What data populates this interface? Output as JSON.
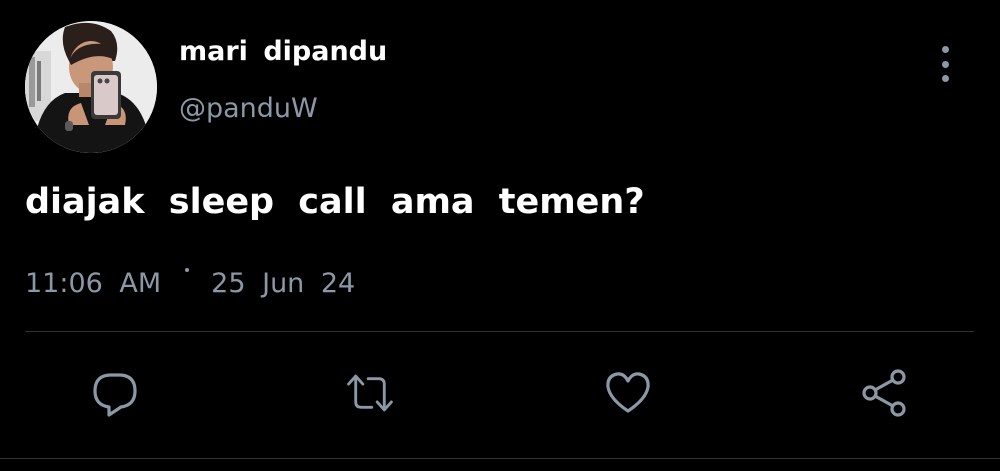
{
  "author": {
    "display_name": "mari dipandu",
    "handle": "@panduW",
    "avatar_icon": "avatar-photo"
  },
  "tweet": {
    "text": "diajak sleep call ama temen?",
    "time": "11:06 AM",
    "date": "25 Jun 24"
  },
  "actions": {
    "reply_icon": "reply-icon",
    "retweet_icon": "retweet-icon",
    "like_icon": "heart-icon",
    "share_icon": "share-icon",
    "more_icon": "more-vertical-icon"
  },
  "colors": {
    "background": "#000000",
    "primary_text": "#ffffff",
    "secondary_text": "#8b98a5",
    "divider": "#2f3336"
  }
}
